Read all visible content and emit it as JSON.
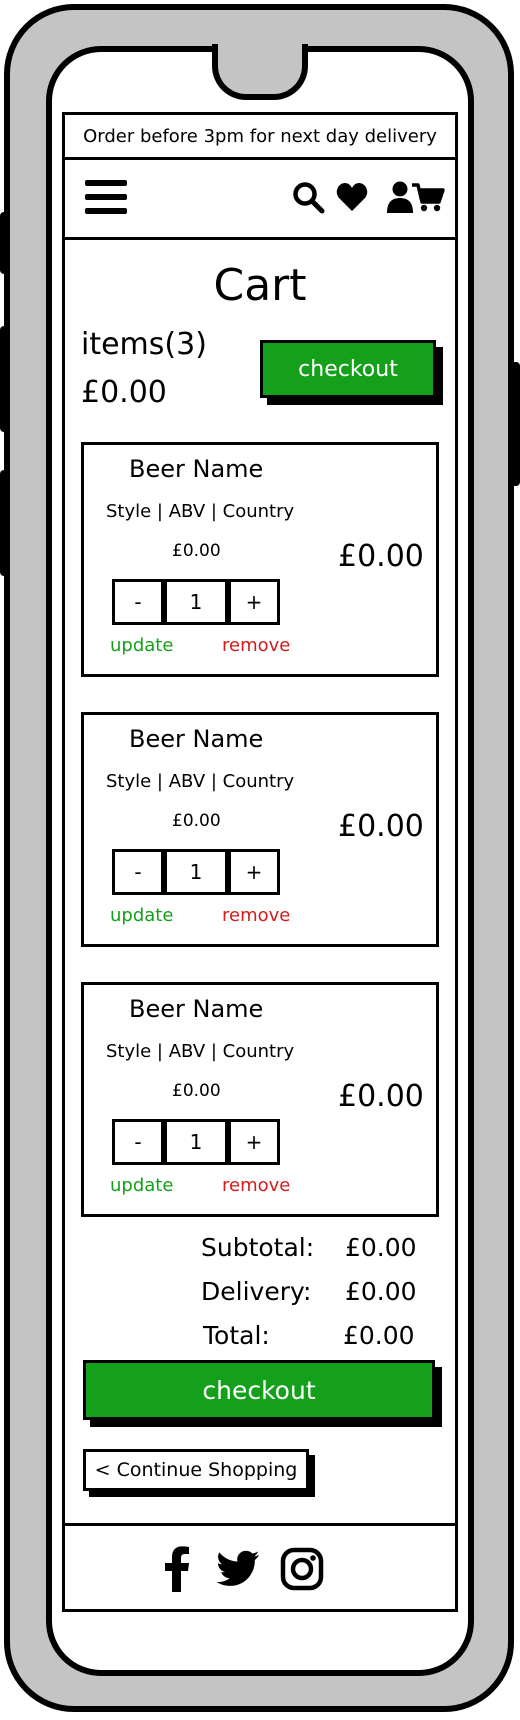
{
  "banner": {
    "text": "Order before 3pm for next day delivery"
  },
  "nav": {
    "icons": [
      "menu-icon",
      "search-icon",
      "heart-icon",
      "user-icon",
      "cart-icon"
    ]
  },
  "cart": {
    "title": "Cart",
    "items_label": "items(3)",
    "total_label": "£0.00",
    "checkout_label": "checkout"
  },
  "items": [
    {
      "name": "Beer Name",
      "meta": "Style | ABV | Country",
      "unit_price": "£0.00",
      "line_price": "£0.00",
      "minus": "-",
      "quantity": "1",
      "plus": "+",
      "update": "update",
      "remove": "remove"
    },
    {
      "name": "Beer Name",
      "meta": "Style | ABV | Country",
      "unit_price": "£0.00",
      "line_price": "£0.00",
      "minus": "-",
      "quantity": "1",
      "plus": "+",
      "update": "update",
      "remove": "remove"
    },
    {
      "name": "Beer Name",
      "meta": "Style | ABV | Country",
      "unit_price": "£0.00",
      "line_price": "£0.00",
      "minus": "-",
      "quantity": "1",
      "plus": "+",
      "update": "update",
      "remove": "remove"
    }
  ],
  "summary": {
    "subtotal_label": "Subtotal:",
    "subtotal_value": "£0.00",
    "delivery_label": "Delivery:",
    "delivery_value": "£0.00",
    "total_label": "Total:",
    "total_value": "£0.00"
  },
  "checkout_bottom": "checkout",
  "continue_shopping": "< Continue Shopping",
  "footer": {
    "icons": [
      "facebook-icon",
      "twitter-icon",
      "instagram-icon"
    ]
  },
  "colors": {
    "accent_green": "#14a01a",
    "remove_red": "#d31b1b",
    "device_gray": "#c4c4c4"
  }
}
